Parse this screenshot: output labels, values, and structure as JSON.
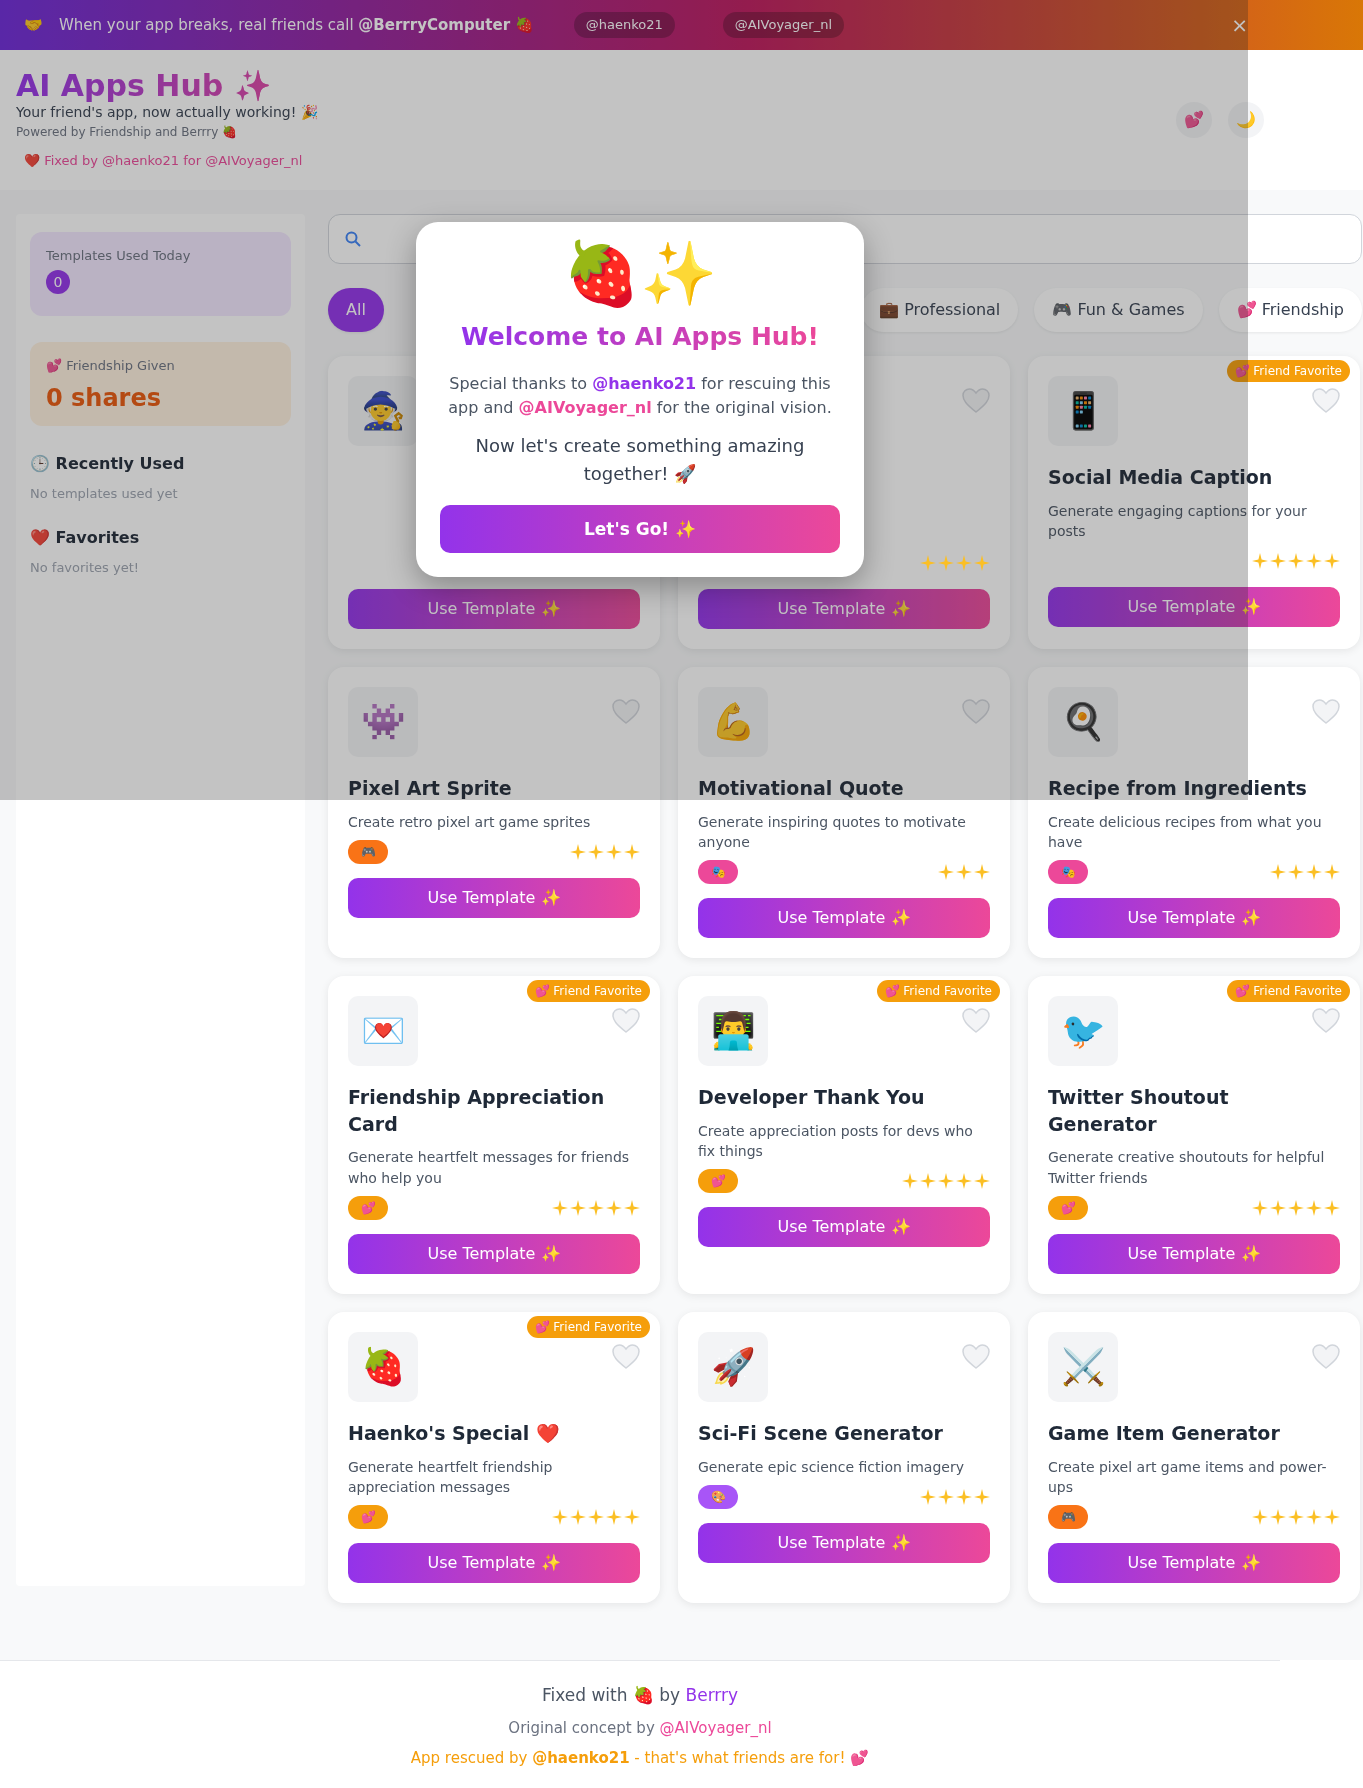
{
  "banner": {
    "icon": "🤝",
    "text": "When your app breaks, real friends call **@BerrryComputer** 🍓",
    "buttons": [
      "@haenko21",
      "@AIVoyager_nl"
    ],
    "close": "×"
  },
  "header": {
    "title": "AI Apps Hub ✨",
    "subtitle": "Your friend's app, now actually working! 🎉",
    "tagline": "Powered by Friendship and Berrry 🍓",
    "credit": "❤️ Fixed by @haenko21 for @AIVoyager_nl",
    "actions": [
      "💕",
      "🌙"
    ]
  },
  "sidebar": {
    "stats": [
      {
        "kind": "count",
        "label": "Templates Used Today",
        "value": "0"
      },
      {
        "kind": "shares",
        "label": "💕 Friendship Given",
        "value": "0 shares"
      }
    ],
    "sections": [
      {
        "title": "🕒 Recently Used",
        "empty": "No templates used yet"
      },
      {
        "title": "❤️ Favorites",
        "empty": "No favorites yet!"
      }
    ]
  },
  "categories": [
    {
      "label": "All",
      "selected": true
    },
    {
      "label": "💼 Professional",
      "selected": false
    },
    {
      "label": "🎮 Fun & Games",
      "selected": false
    },
    {
      "label": "💕 Friendship",
      "selected": false
    }
  ],
  "templates": [
    {
      "icon": "🧙",
      "button": "Use Template ✨"
    },
    {
      "stars": 4,
      "button": "Use Template ✨"
    },
    {
      "icon": "📱",
      "title": "Social Media Caption",
      "description": "Generate engaging captions for your posts",
      "stars": 5,
      "badge": "💕 Friend Favorite",
      "button": "Use Template ✨"
    },
    {
      "icon": "👾",
      "title": "Pixel Art Sprite",
      "description": "Create retro pixel art game sprites",
      "tag": {
        "icon": "🎮",
        "color": "#f97316"
      },
      "stars": 4,
      "button": "Use Template ✨"
    },
    {
      "icon": "💪",
      "title": "Motivational Quote",
      "description": "Generate inspiring quotes to motivate anyone",
      "tag": {
        "icon": "🎭",
        "color": "#ec4899"
      },
      "stars": 3,
      "button": "Use Template ✨"
    },
    {
      "icon": "🍳",
      "title": "Recipe from Ingredients",
      "description": "Create delicious recipes from what you have",
      "tag": {
        "icon": "🎭",
        "color": "#ec4899"
      },
      "stars": 4,
      "button": "Use Template ✨"
    },
    {
      "icon": "💌",
      "title": "Friendship Appreciation Card",
      "description": "Generate heartfelt messages for friends who help you",
      "tag": {
        "icon": "💕",
        "color": "#f59e0b"
      },
      "stars": 5,
      "badge": "💕 Friend Favorite",
      "button": "Use Template ✨"
    },
    {
      "icon": "👨‍💻",
      "title": "Developer Thank You",
      "description": "Create appreciation posts for devs who fix things",
      "tag": {
        "icon": "💕",
        "color": "#f59e0b"
      },
      "stars": 5,
      "badge": "💕 Friend Favorite",
      "button": "Use Template ✨"
    },
    {
      "icon": "🐦",
      "title": "Twitter Shoutout Generator",
      "description": "Generate creative shoutouts for helpful Twitter friends",
      "tag": {
        "icon": "💕",
        "color": "#f59e0b"
      },
      "stars": 5,
      "badge": "💕 Friend Favorite",
      "button": "Use Template ✨"
    },
    {
      "icon": "🍓",
      "title": "Haenko's Special ❤️",
      "description": "Generate heartfelt friendship appreciation messages",
      "tag": {
        "icon": "💕",
        "color": "#f59e0b"
      },
      "stars": 5,
      "badge": "💕 Friend Favorite",
      "button": "Use Template ✨"
    },
    {
      "icon": "🚀",
      "title": "Sci-Fi Scene Generator",
      "description": "Generate epic science fiction imagery",
      "tag": {
        "icon": "🎨",
        "color": "#a855f7"
      },
      "stars": 4,
      "button": "Use Template ✨"
    },
    {
      "icon": "⚔️",
      "title": "Game Item Generator",
      "description": "Create pixel art game items and power-ups",
      "tag": {
        "icon": "🎮",
        "color": "#f97316"
      },
      "stars": 5,
      "button": "Use Template ✨"
    }
  ],
  "modal": {
    "icon": "🍓✨",
    "title": "Welcome to AI Apps Hub!",
    "thanks": [
      {
        "kind": "plain",
        "text": "Special thanks to "
      },
      {
        "kind": "primary",
        "text": "@haenko21"
      },
      {
        "kind": "plain",
        "text": " for rescuing this app and "
      },
      {
        "kind": "secondary",
        "text": "@AIVoyager_nl"
      },
      {
        "kind": "plain",
        "text": " for the original vision."
      }
    ],
    "message": "Now let's create something amazing together! 🚀",
    "button": "Let's Go! ✨"
  },
  "footer": {
    "fixed": {
      "text": "Fixed with 🍓 by ",
      "link": "Berrry"
    },
    "concept": {
      "text": "Original concept by ",
      "link": "@AIVoyager_nl"
    },
    "rescued": "App rescued by **@haenko21** - that's what friends are for! 💕"
  }
}
